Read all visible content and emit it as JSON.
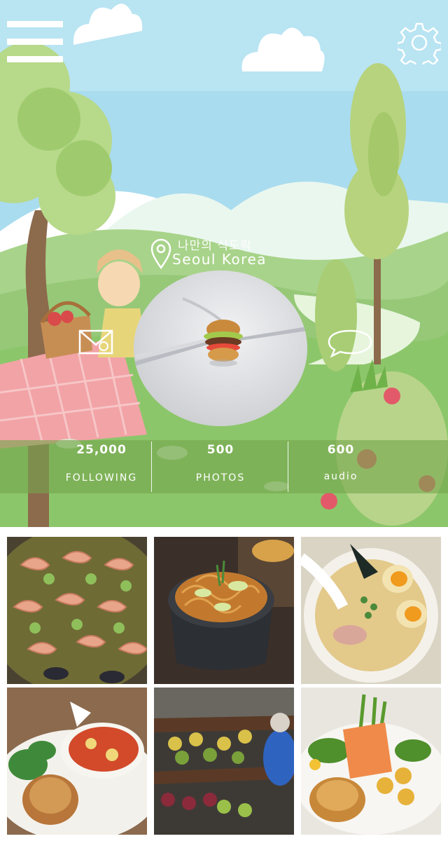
{
  "header": {
    "menu_icon": "hamburger-menu-icon",
    "settings_icon": "gear-icon"
  },
  "profile": {
    "location_icon": "location-pin-icon",
    "name": "나만의 식도락",
    "location": "Seoul Korea",
    "mail_icon": "envelope-icon",
    "chat_icon": "speech-bubble-icon"
  },
  "stats": [
    {
      "value": "25,000",
      "label": "FOLLOWING"
    },
    {
      "value": "500",
      "label": "PHOTOS"
    },
    {
      "value": "600",
      "label": "audio"
    }
  ],
  "photos": [
    {
      "subject": "shrimp paella"
    },
    {
      "subject": "stir-fried noodles in pot"
    },
    {
      "subject": "ramen with eggs"
    },
    {
      "subject": "bread and shakshuka plate"
    },
    {
      "subject": "floating market boats"
    },
    {
      "subject": "salmon salad plate"
    }
  ],
  "colors": {
    "sky": "#a8dcee",
    "grass": "#8cc66a",
    "stats_band": "#76a64e",
    "text": "#ffffff"
  }
}
